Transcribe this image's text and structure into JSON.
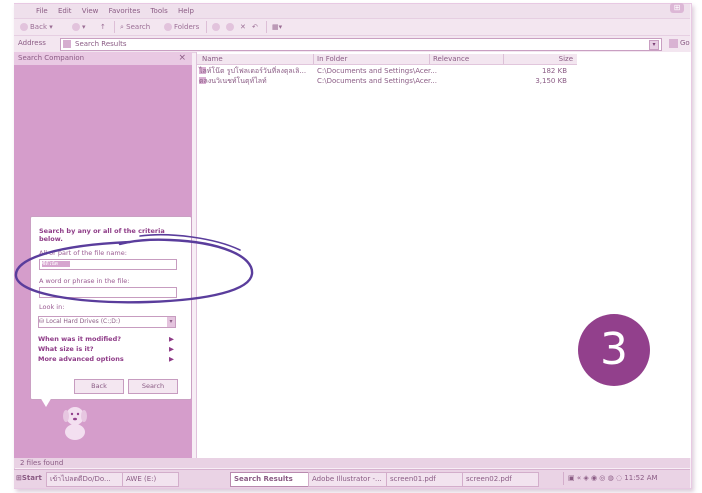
{
  "menu": [
    "File",
    "Edit",
    "View",
    "Favorites",
    "Tools",
    "Help"
  ],
  "toolbar": {
    "back": "Back",
    "search": "Search",
    "folders": "Folders"
  },
  "address": {
    "label": "Address",
    "value": "Search Results",
    "go": "Go"
  },
  "sidebar": {
    "title": "Search Companion",
    "close": "×",
    "prompt": "Search by any or all of the criteria below.",
    "file_name_label": "All or part of the file name:",
    "file_name_value": "ซีดีโน้ต",
    "phrase_label": "A word or phrase in the file:",
    "phrase_value": "",
    "look_in_label": "Look in:",
    "look_in_value": "Local Hard Drives (C:;D:)",
    "options": [
      "When was it modified?",
      "What size is it?",
      "More advanced options"
    ],
    "back_button": "Back",
    "search_button": "Search"
  },
  "results": {
    "columns": [
      "Name",
      "In Folder",
      "Relevance",
      "Size"
    ],
    "rows": [
      {
        "name": "ไลท์โน๊ต รูปโฟลเดอร์วันที่ลงตุลเลิ...",
        "folder": "C:\\Documents and Settings\\Acer...",
        "size": "182 KB"
      },
      {
        "name": "ดลงนวิเนชท์โนตุท์ไลท์",
        "folder": "C:\\Documents and Settings\\Acer...",
        "size": "3,150 KB"
      }
    ]
  },
  "step_number": "3",
  "status": "2 files found",
  "taskbar": {
    "start": "Start",
    "tasks": [
      "เข้าไปลตดีDo/Do...",
      "AWE (E:)",
      "Search Results",
      "Adobe Illustrator -...",
      "screen01.pdf",
      "screen02.pdf"
    ],
    "clock": "11:52 AM"
  },
  "colors": {
    "accent": "#92408c",
    "sidebar": "#d59dcb",
    "highlight_oval": "#5a3d9c"
  }
}
